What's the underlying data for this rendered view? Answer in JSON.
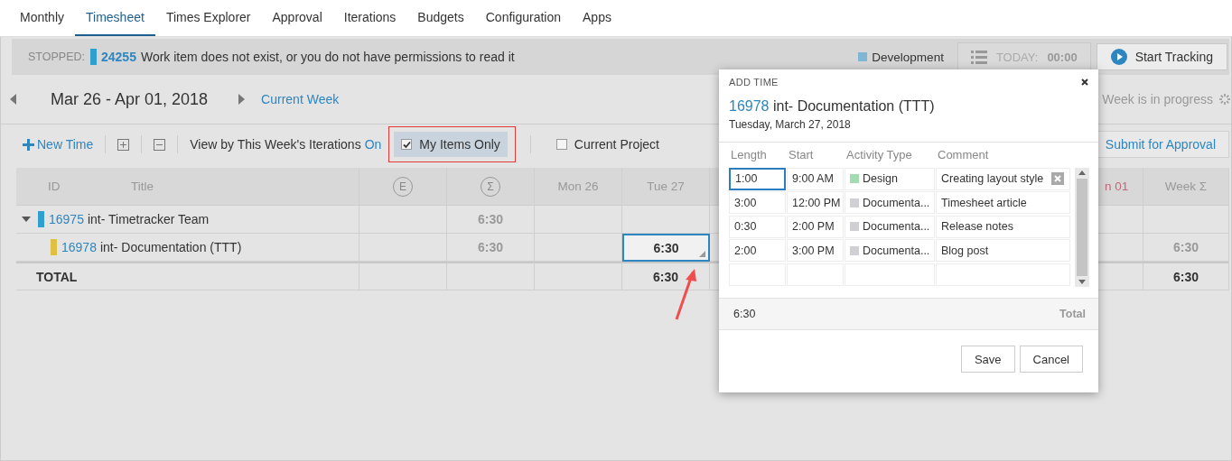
{
  "nav": {
    "tabs": [
      {
        "label": "Monthly",
        "selected": false
      },
      {
        "label": "Timesheet",
        "selected": true
      },
      {
        "label": "Times Explorer",
        "selected": false
      },
      {
        "label": "Approval",
        "selected": false
      },
      {
        "label": "Iterations",
        "selected": false
      },
      {
        "label": "Budgets",
        "selected": false
      },
      {
        "label": "Configuration",
        "selected": false
      },
      {
        "label": "Apps",
        "selected": false
      }
    ]
  },
  "status": {
    "state": "STOPPED:",
    "item": {
      "id": "24255",
      "color": "#2e9fcf"
    },
    "message": "Work item does not exist, or you do not have permissions to read it",
    "activity": {
      "label": "Development",
      "color": "#7fb6d6"
    },
    "today_label": "TODAY:",
    "today_value": "00:00",
    "start_button": "Start Tracking"
  },
  "week": {
    "range": "Mar 26 - Apr 01, 2018",
    "current_week": "Current Week",
    "progress": "Week is in progress"
  },
  "toolbar": {
    "new_time": "New Time",
    "view_label": "View by This Week's Iterations",
    "view_value": "On",
    "filters": [
      {
        "label": "My Items Only",
        "checked": true
      },
      {
        "label": "Current Project",
        "checked": false
      }
    ],
    "submit": "Submit for Approval"
  },
  "grid": {
    "columns": [
      {
        "label": "ID",
        "kind": "text"
      },
      {
        "label": "Title",
        "kind": "text"
      },
      {
        "label": "E",
        "kind": "circle"
      },
      {
        "label": "Σ",
        "kind": "circle"
      },
      {
        "label": "Mon 26",
        "kind": "text"
      },
      {
        "label": "Tue 27",
        "kind": "text"
      },
      {
        "label": "n 01",
        "kind": "weekend"
      },
      {
        "label": "Week Σ",
        "kind": "text"
      }
    ],
    "rows": [
      {
        "id": "16975",
        "title": "int- Timetracker Team",
        "color": "#2e9fcf",
        "expanded": true,
        "sum": "6:30",
        "children": [
          {
            "id": "16978",
            "title": "int- Documentation (TTT)",
            "color": "#e0c040",
            "sum": "6:30",
            "tue": "6:30",
            "week": "6:30",
            "selected": true
          }
        ]
      }
    ],
    "total": {
      "label": "TOTAL",
      "tue": "6:30",
      "week": "6:30"
    }
  },
  "dialog": {
    "title": "ADD TIME",
    "item_id": "16978",
    "item_title": "int- Documentation (TTT)",
    "date": "Tuesday, March 27, 2018",
    "columns": [
      "Length",
      "Start",
      "Activity Type",
      "Comment"
    ],
    "entries": [
      {
        "length": "1:00",
        "start": "9:00 AM",
        "activity": {
          "label": "Design",
          "color": "#a3dcb0"
        },
        "comment": "Creating layout style",
        "selected": true
      },
      {
        "length": "3:00",
        "start": "12:00 PM",
        "activity": {
          "label": "Documenta...",
          "color": "#d0d0d4"
        },
        "comment": "Timesheet article",
        "selected": false
      },
      {
        "length": "0:30",
        "start": "2:00 PM",
        "activity": {
          "label": "Documenta...",
          "color": "#d0d0d4"
        },
        "comment": "Release notes",
        "selected": false
      },
      {
        "length": "2:00",
        "start": "3:00 PM",
        "activity": {
          "label": "Documenta...",
          "color": "#d0d0d4"
        },
        "comment": "Blog post",
        "selected": false
      }
    ],
    "total_value": "6:30",
    "total_label": "Total",
    "buttons": [
      "Save",
      "Cancel"
    ]
  }
}
